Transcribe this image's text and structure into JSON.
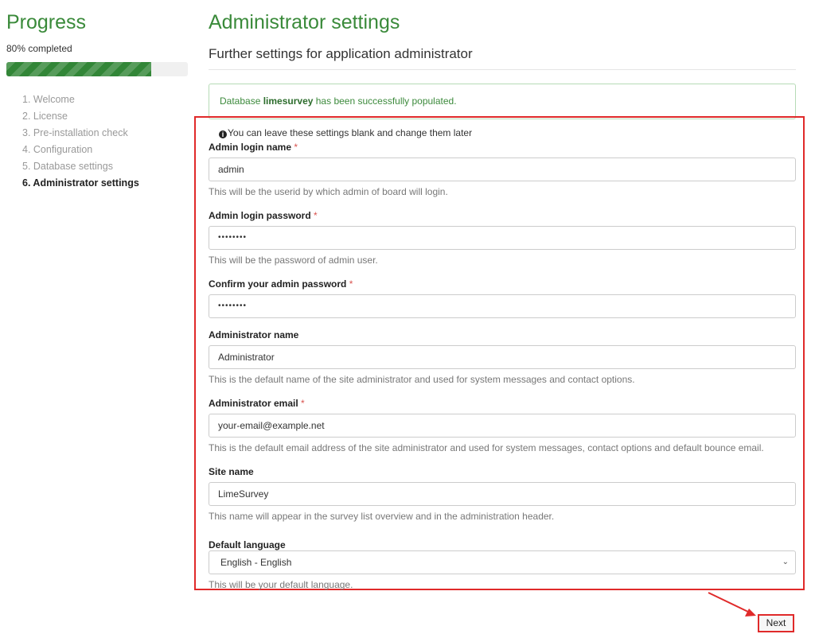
{
  "sidebar": {
    "title": "Progress",
    "completed_text": "80% completed",
    "progress_fraction": 0.8,
    "steps": [
      "1. Welcome",
      "2. License",
      "3. Pre-installation check",
      "4. Configuration",
      "5. Database settings",
      "6. Administrator settings"
    ],
    "active_step_index": 5
  },
  "main": {
    "title": "Administrator settings",
    "subtitle": "Further settings for application administrator",
    "alert": {
      "prefix": "Database ",
      "db_name": "limesurvey",
      "suffix": " has been successfully populated."
    },
    "note_icon": "info-circle-icon",
    "note": "You can leave these settings blank and change them later",
    "fields": {
      "login_name": {
        "label": "Admin login name",
        "required": "*",
        "value": "admin",
        "help": "This will be the userid by which admin of board will login."
      },
      "password": {
        "label": "Admin login password",
        "required": "*",
        "value": "••••••••",
        "help": "This will be the password of admin user."
      },
      "confirm_password": {
        "label": "Confirm your admin password",
        "required": "*",
        "value": "••••••••"
      },
      "admin_name": {
        "label": "Administrator name",
        "value": "Administrator",
        "help": "This is the default name of the site administrator and used for system messages and contact options."
      },
      "admin_email": {
        "label": "Administrator email",
        "required": "*",
        "value": "your-email@example.net",
        "help": "This is the default email address of the site administrator and used for system messages, contact options and default bounce email."
      },
      "site_name": {
        "label": "Site name",
        "value": "LimeSurvey",
        "help": "This name will appear in the survey list overview and in the administration header."
      },
      "language": {
        "label": "Default language",
        "value": "English - English",
        "help": "This will be your default language."
      }
    },
    "next_label": "Next"
  },
  "colors": {
    "accent_green": "#3a8a3a",
    "progress_green": "#328637",
    "highlight_red": "#e02a2a"
  }
}
